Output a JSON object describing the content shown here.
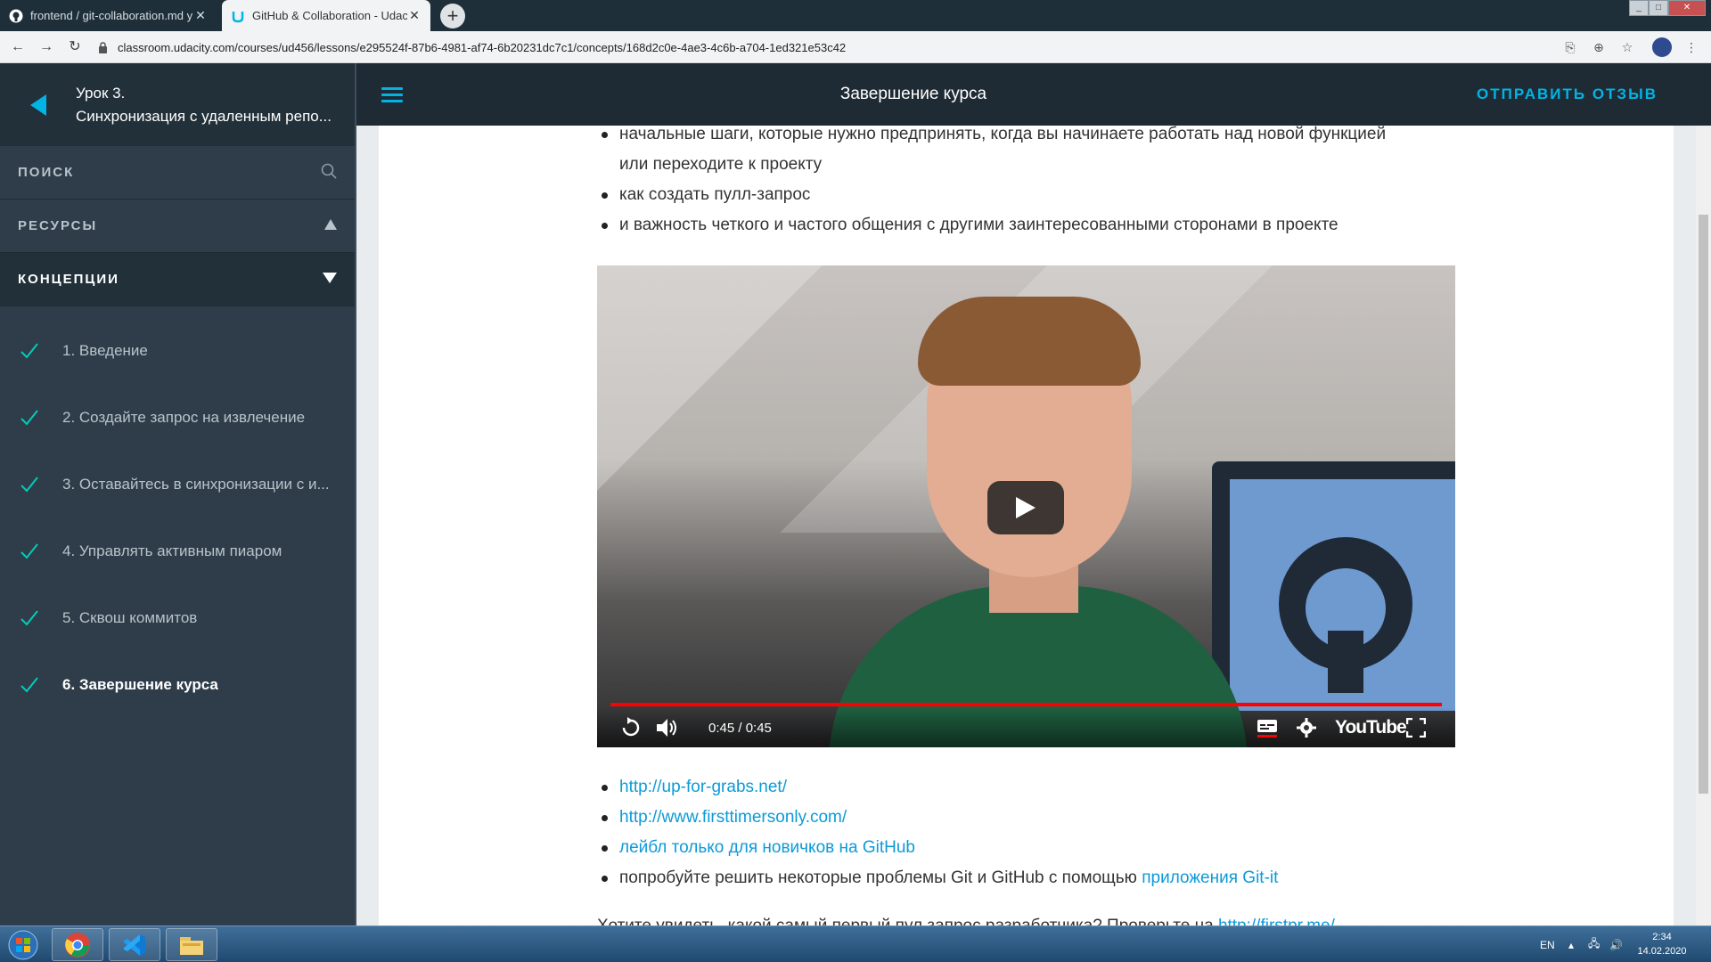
{
  "browser": {
    "tabs": [
      {
        "title": "frontend / git-collaboration.md y",
        "favicon": "github-icon"
      },
      {
        "title": "GitHub & Collaboration - Udacity",
        "favicon": "udacity-icon"
      }
    ],
    "new_tab_symbol": "+",
    "url": "classroom.udacity.com/courses/ud456/lessons/e295524f-87b6-4981-af74-6b20231dc7c1/concepts/168d2c0e-4ae3-4c6b-a704-1ed321e53c42"
  },
  "sidebar": {
    "lesson_number": "Урок 3.",
    "lesson_title": "Синхронизация с удаленным репо...",
    "search_label": "ПОИСК",
    "resources_label": "РЕСУРСЫ",
    "concepts_label": "КОНЦЕПЦИИ",
    "concepts": [
      {
        "label": "1. Введение"
      },
      {
        "label": "2. Создайте запрос на извлечение"
      },
      {
        "label": "3. Оставайтесь в синхронизации с и..."
      },
      {
        "label": "4. Управлять активным пиаром"
      },
      {
        "label": "5. Сквош коммитов"
      },
      {
        "label": "6. Завершение курса"
      }
    ],
    "accent_color": "#02b3e4"
  },
  "header": {
    "concept_title": "Завершение курса",
    "feedback_label": "ОТПРАВИТЬ ОТЗЫВ"
  },
  "content": {
    "top_bullets": [
      "начальные шаги, которые нужно предпринять, когда вы начинаете работать над новой функцией",
      "или переходите к проекту",
      "как создать пулл-запрос",
      "и важность четкого и частого общения с другими заинтересованными сторонами в проекте"
    ],
    "video": {
      "time": "0:45 / 0:45",
      "progress": 1.0,
      "brand": "YouTube"
    },
    "links": {
      "up_for_grabs": "http://up-for-grabs.net/",
      "first_timers": "http://www.firsttimersonly.com/",
      "newbie_label": "лейбл только для новичков на GitHub",
      "gitit_prefix": "попробуйте решить некоторые проблемы Git и GitHub с помощью ",
      "gitit_link": "приложения Git-it"
    },
    "cut_line_text": "Хотите увидеть, какой самый первый пул запрос разработчика? Проверьте на ",
    "cut_line_link": "http://firstpr.me/"
  },
  "taskbar": {
    "language": "EN",
    "time": "2:34",
    "date": "14.02.2020"
  }
}
